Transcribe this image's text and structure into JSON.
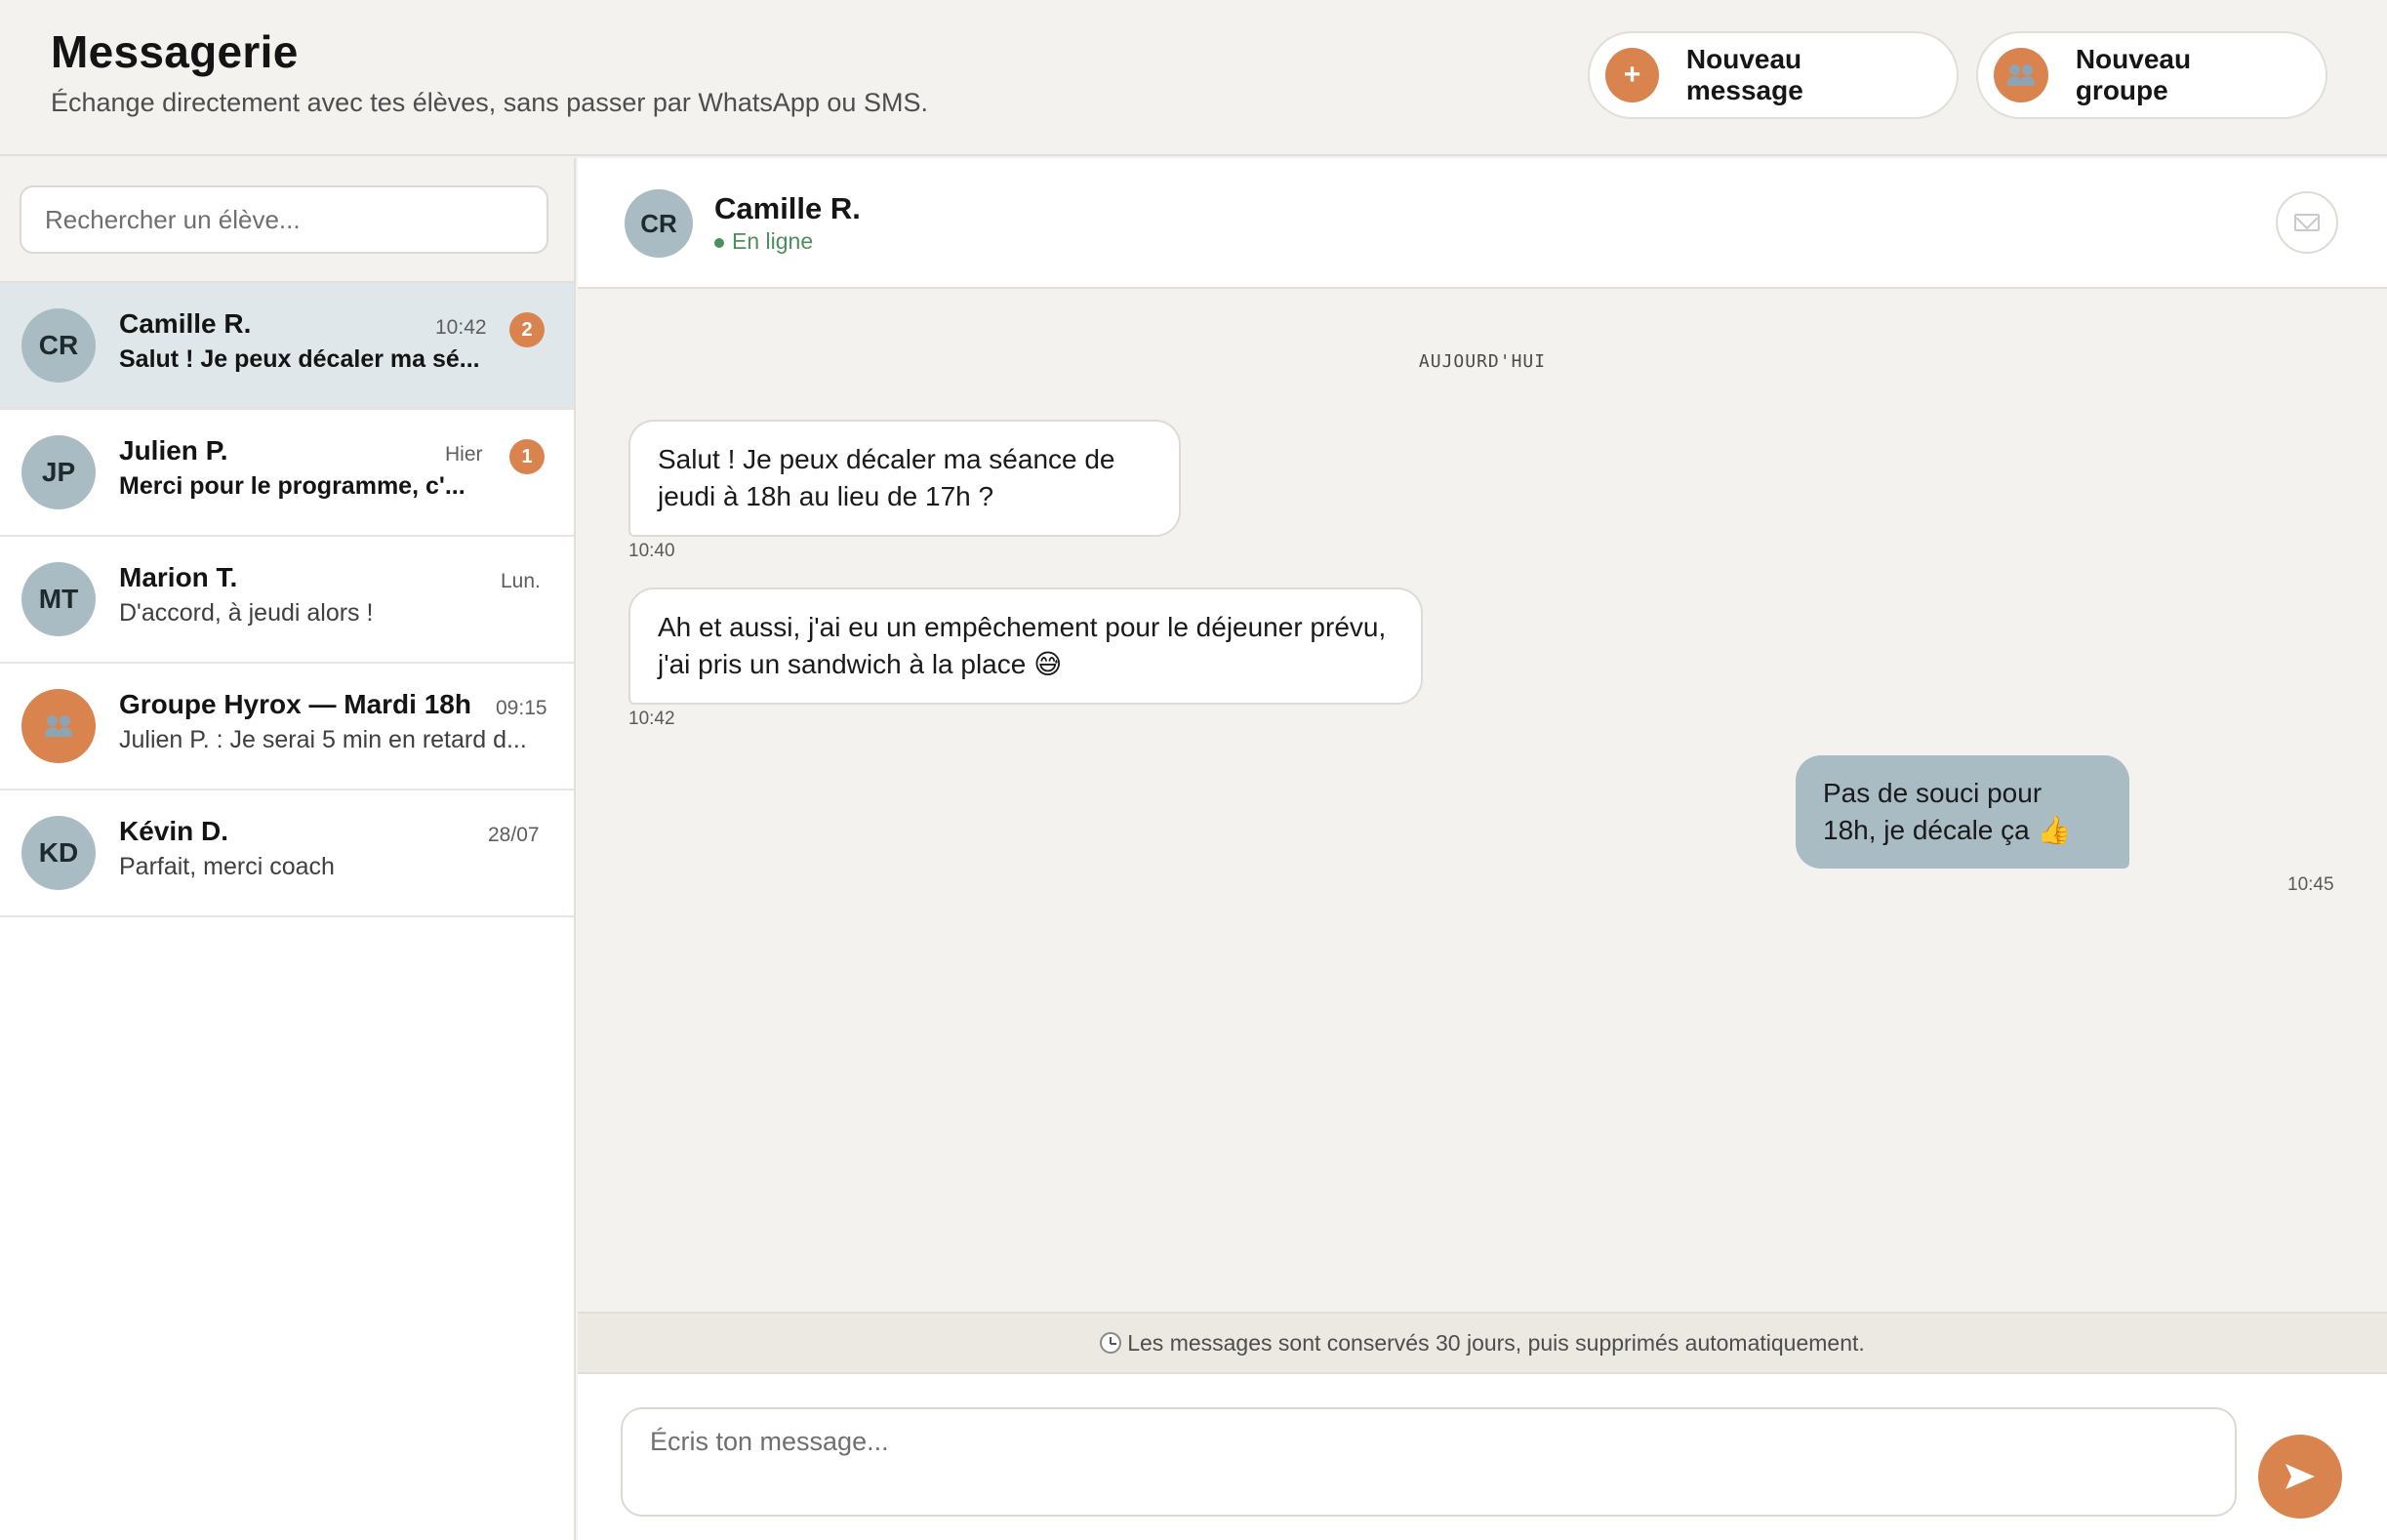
{
  "header": {
    "title": "Messagerie",
    "subtitle": "Échange directement avec tes élèves, sans passer par WhatsApp ou SMS.",
    "new_message_label": "Nouveau message",
    "new_message_icon": "+",
    "new_group_label": "Nouveau groupe"
  },
  "sidebar": {
    "search_placeholder": "Rechercher un élève...",
    "conversations": [
      {
        "initials": "CR",
        "name": "Camille R.",
        "time": "10:42",
        "preview": "Salut ! Je peux décaler ma sé...",
        "unread": "2",
        "active": true
      },
      {
        "initials": "JP",
        "name": "Julien P.",
        "time": "Hier",
        "preview": "Merci pour le programme, c'...",
        "unread": "1"
      },
      {
        "initials": "MT",
        "name": "Marion T.",
        "time": "Lun.",
        "preview": "D'accord, à jeudi alors !"
      },
      {
        "icon": "group-icon",
        "name": "Groupe Hyrox — Mardi 18h",
        "time": "09:15",
        "preview": "Julien P. : Je serai 5 min en retard d..."
      },
      {
        "initials": "KD",
        "name": "Kévin D.",
        "time": "28/07",
        "preview": "Parfait, merci coach"
      }
    ]
  },
  "chat": {
    "initials": "CR",
    "name": "Camille R.",
    "status": "En ligne",
    "day_separator": "AUJOURD'HUI",
    "messages": [
      {
        "direction": "in",
        "text": "Salut ! Je peux décaler ma séance de jeudi à 18h au lieu de 17h ?",
        "time": "10:40"
      },
      {
        "direction": "in",
        "text": "Ah et aussi, j'ai eu un empêchement pour le déjeuner prévu, j'ai pris un sandwich à la place 😅",
        "time": "10:42"
      },
      {
        "direction": "out",
        "text": "Pas de souci pour 18h, je décale ça 👍",
        "time": "10:45"
      }
    ],
    "retention_notice": "Les messages sont conservés 30 jours, puis supprimés automatiquement.",
    "composer_placeholder": "Écris ton message..."
  },
  "colors": {
    "accent": "#d9844e",
    "avatar": "#a9bcc4",
    "active_row": "#e0e7ea",
    "online": "#4d8f5c",
    "background": "#f4f2ee"
  }
}
